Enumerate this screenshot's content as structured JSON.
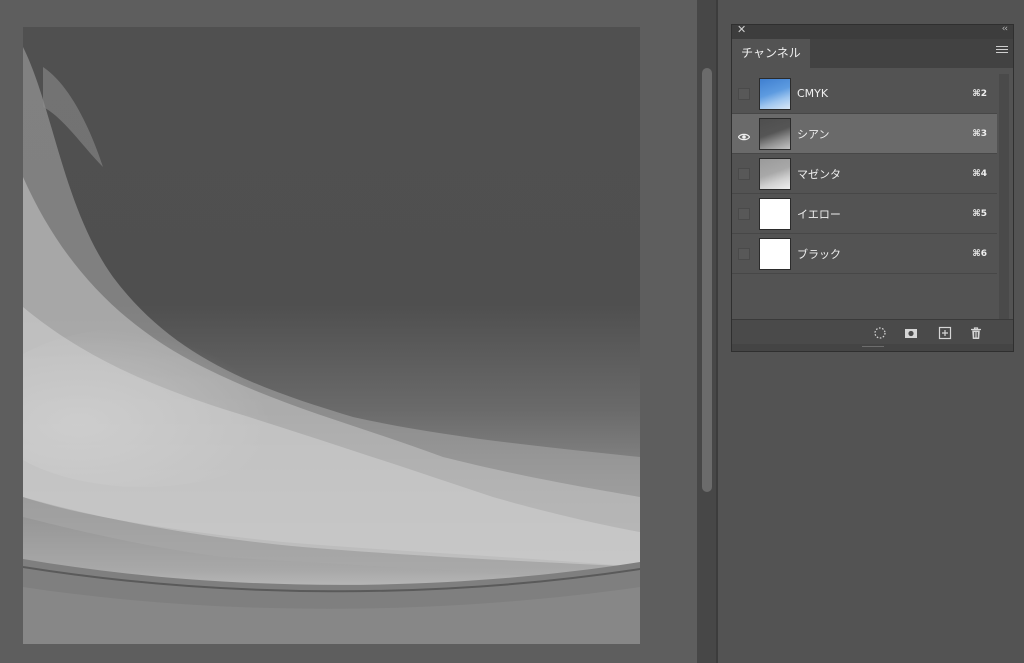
{
  "panel": {
    "close_glyph": "✕",
    "collapse_glyph": "‹‹",
    "tab_label": "チャンネル",
    "menu_icon": "hamburger-menu-icon"
  },
  "channels": [
    {
      "name": "CMYK",
      "shortcut": "⌘2",
      "visible": false,
      "selected": false,
      "thumb": "composite-color"
    },
    {
      "name": "シアン",
      "shortcut": "⌘3",
      "visible": true,
      "selected": true,
      "thumb": "grayscale-dark"
    },
    {
      "name": "マゼンタ",
      "shortcut": "⌘4",
      "visible": false,
      "selected": false,
      "thumb": "grayscale-light"
    },
    {
      "name": "イエロー",
      "shortcut": "⌘5",
      "visible": false,
      "selected": false,
      "thumb": "white"
    },
    {
      "name": "ブラック",
      "shortcut": "⌘6",
      "visible": false,
      "selected": false,
      "thumb": "white"
    }
  ],
  "footer_icons": [
    "load-selection-icon",
    "save-selection-icon",
    "new-channel-icon",
    "trash-icon"
  ],
  "colors": {
    "app_background": "#535353",
    "canvas_background": "#5e5e5e",
    "selected_row": "#6a6a6a"
  }
}
